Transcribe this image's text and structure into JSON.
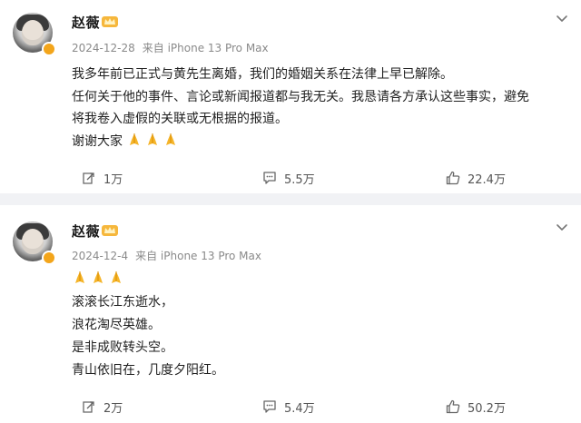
{
  "posts": [
    {
      "author": "赵薇",
      "date": "2024-12-28",
      "source": "来自 iPhone 13 Pro Max",
      "lines": [
        "我多年前已正式与黄先生离婚，我们的婚姻关系在法律上早已解除。",
        "任何关于他的事件、言论或新闻报道都与我无关。我恳请各方承认这些事实，避免",
        "将我卷入虚假的关联或无根据的报道。",
        "谢谢大家"
      ],
      "emoji_count": 3,
      "reposts": "1万",
      "comments": "5.5万",
      "likes": "22.4万"
    },
    {
      "author": "赵薇",
      "date": "2024-12-4",
      "source": "来自 iPhone 13 Pro Max",
      "lines": [
        "滚滚长江东逝水，",
        "浪花淘尽英雄。",
        "是非成败转头空。",
        "青山依旧在，几度夕阳红。"
      ],
      "emoji_count": 3,
      "reposts": "2万",
      "comments": "5.4万",
      "likes": "50.2万"
    }
  ],
  "icons": {
    "avatar_badge": "verified-badge-icon",
    "crown": "vip-crown-icon",
    "menu": "chevron-down-icon",
    "repost": "repost-icon",
    "comment": "comment-icon",
    "like": "thumbs-up-icon",
    "emoji": "praying-hands-icon"
  },
  "colors": {
    "background": "#f1f2f5",
    "card": "#ffffff",
    "meta_text": "#8a8a8a",
    "accent_orange": "#f3a51b"
  }
}
